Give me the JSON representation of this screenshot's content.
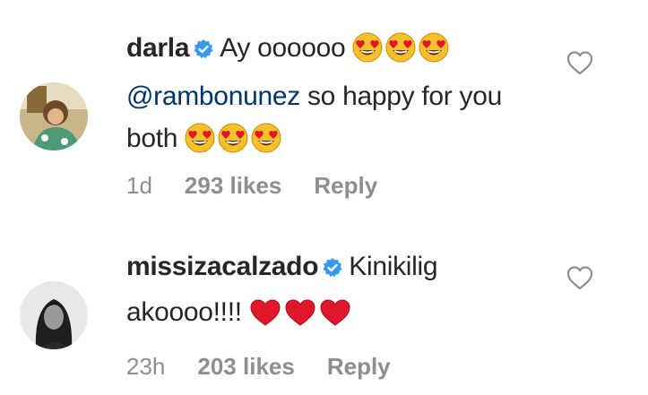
{
  "comments": [
    {
      "username": "darla",
      "verified": true,
      "text_before": "Ay oooooo",
      "mention": "@rambonunez",
      "text_after": " so happy for you both",
      "time": "1d",
      "likes": "293 likes",
      "reply_label": "Reply"
    },
    {
      "username": "missizacalzado",
      "verified": true,
      "text": "Kinikilig akoooo!!!!",
      "time": "23h",
      "likes": "203 likes",
      "reply_label": "Reply"
    }
  ],
  "icons": {
    "verified": "verified-badge-icon",
    "like": "heart-outline-icon",
    "emoji_eyes": "heart-eyes-emoji",
    "emoji_heart": "red-heart-emoji"
  },
  "colors": {
    "verified_blue": "#3897f0",
    "mention": "#003569",
    "meta_gray": "#8e8e8e",
    "emoji_yellow": "#f6c02b",
    "heart_red": "#e0162b"
  }
}
